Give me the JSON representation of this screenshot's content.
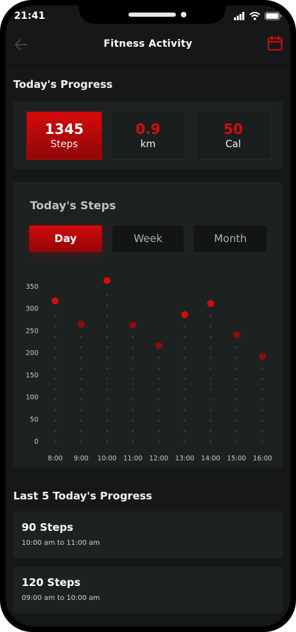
{
  "status": {
    "time": "21:41"
  },
  "header": {
    "title": "Fitness Activity",
    "back_icon": "arrow-left-icon",
    "calendar_icon": "calendar-icon"
  },
  "colors": {
    "accent": "#d40c0c",
    "background": "#151718",
    "card": "#1e2122"
  },
  "progress": {
    "title": "Today's Progress",
    "stats": [
      {
        "value": "1345",
        "label": "Steps"
      },
      {
        "value": "0.9",
        "label": "km"
      },
      {
        "value": "50",
        "label": "Cal"
      }
    ]
  },
  "steps_chart": {
    "title": "Today's Steps",
    "tabs": [
      "Day",
      "Week",
      "Month"
    ],
    "selected_tab": "Day"
  },
  "chart_data": {
    "type": "scatter",
    "title": "",
    "xlabel": "",
    "ylabel": "",
    "categories": [
      "8:00",
      "9:00",
      "10:00",
      "11:00",
      "12:00",
      "13:00",
      "14:00",
      "15:00",
      "16:00"
    ],
    "values": [
      318,
      265,
      364,
      263,
      217,
      287,
      312,
      241,
      192
    ],
    "yticks": [
      0,
      50,
      100,
      150,
      200,
      250,
      300,
      350
    ],
    "ylim": [
      0,
      360
    ],
    "grid": false
  },
  "history": {
    "title": "Last 5 Today's Progress",
    "entries": [
      {
        "steps": "90 Steps",
        "range": "10:00 am to 11:00 am"
      },
      {
        "steps": "120 Steps",
        "range": "09:00 am to 10:00 am"
      }
    ]
  }
}
